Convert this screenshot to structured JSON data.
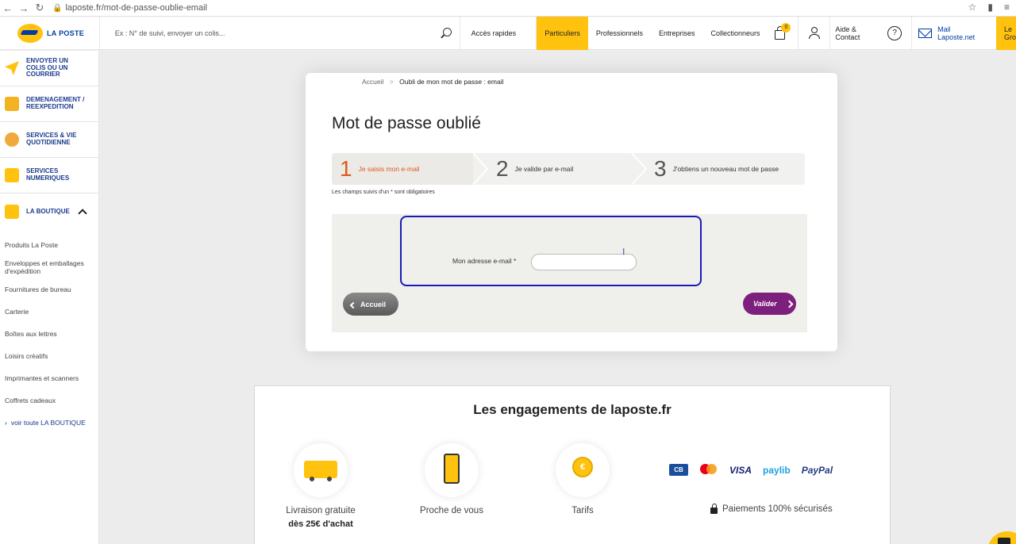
{
  "browser": {
    "url": "laposte.fr/mot-de-passe-oublie-email"
  },
  "header": {
    "logo_text": "LA POSTE",
    "search_placeholder": "Ex : N° de suivi, envoyer un colis...",
    "acces_rapides": "Accès rapides",
    "menu": [
      "Particuliers",
      "Professionnels",
      "Entreprises",
      "Collectionneurs"
    ],
    "cart_count": "0",
    "aide": "Aide & Contact",
    "mail": "Mail Laposte.net",
    "groupe": "Le Gro"
  },
  "sidebar": {
    "categories": [
      {
        "label": "ENVOYER UN COLIS OU UN COURRIER",
        "color": "#ffc20e"
      },
      {
        "label": "DEMENAGEMENT / REEXPEDITION",
        "color": "#f2b320"
      },
      {
        "label": "SERVICES & VIE QUOTIDIENNE",
        "color": "#f0a93a"
      },
      {
        "label": "SERVICES NUMERIQUES",
        "color": "#ffc20e"
      },
      {
        "label": "LA BOUTIQUE",
        "color": "#ffc20e"
      }
    ],
    "shop_items": [
      "Produits La Poste",
      "Enveloppes et emballages d'expédition",
      "Fournitures de bureau",
      "Carterie",
      "Boîtes aux lettres",
      "Loisirs créatifs",
      "Imprimantes et scanners",
      "Coffrets cadeaux"
    ],
    "see_all": "voir toute LA BOUTIQUE"
  },
  "breadcrumb": {
    "home": "Accueil",
    "separator": ">",
    "current": "Oubli de mon mot de passe : email"
  },
  "page": {
    "title": "Mot de passe oublié",
    "steps": [
      {
        "num": "1",
        "label": "Je saisis mon e-mail"
      },
      {
        "num": "2",
        "label": "Je valide par e-mail"
      },
      {
        "num": "3",
        "label": "J'obtiens un nouveau mot de passe"
      }
    ],
    "required_note": "Les champs suivis d'un * sont obligatoires",
    "email_label": "Mon adresse e-mail *",
    "email_value": "",
    "btn_back": "Accueil",
    "btn_submit": "Valider"
  },
  "engagements": {
    "title": "Les engagements de laposte.fr",
    "features": [
      {
        "name": "Livraison gratuite",
        "sub": "dès 25€ d'achat"
      },
      {
        "name": "Proche de vous",
        "sub": ""
      },
      {
        "name": "Tarifs",
        "sub": ""
      }
    ],
    "payments": [
      "CB",
      "Mastercard",
      "VISA",
      "paylib",
      "PayPal"
    ],
    "secure": "Paiements 100% sécurisés"
  }
}
